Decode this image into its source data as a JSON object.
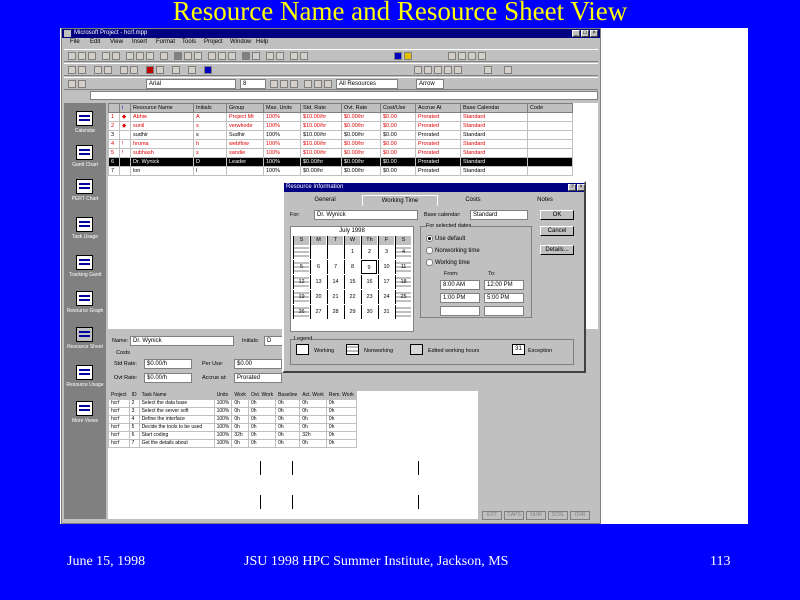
{
  "slide": {
    "title": "Resource Name and Resource Sheet View",
    "footer_date": "June 15,  1998",
    "footer_event": "JSU 1998 HPC Summer Institute, Jackson, MS",
    "page_number": "113"
  },
  "window": {
    "title": "Microsoft Project - hcrf.mpp",
    "menus": [
      "File",
      "Edit",
      "View",
      "Insert",
      "Format",
      "Tools",
      "Project",
      "Window",
      "Help"
    ]
  },
  "toolbar": {
    "font_box": "Arial",
    "size_box": "8",
    "filter_box": "All Resources",
    "zoom_label": "Arrow"
  },
  "viewbar": [
    {
      "label": "Calendar"
    },
    {
      "label": "Gantt Chart"
    },
    {
      "label": "PERT Chart"
    },
    {
      "label": "Task Usage"
    },
    {
      "label": "Tracking Gantt"
    },
    {
      "label": "Resource Graph"
    },
    {
      "label": "Resource Sheet"
    },
    {
      "label": "Resource Usage"
    },
    {
      "label": "More Views"
    }
  ],
  "sheet": {
    "headers": [
      "",
      "i",
      "Resource Name",
      "Initials",
      "Group",
      "Max. Units",
      "Std. Rate",
      "Ovt. Rate",
      "Cost/Use",
      "Accrue At",
      "Base Calendar",
      "Code"
    ],
    "rows": [
      {
        "id": "1",
        "name": "Abhie",
        "initials": "A",
        "group": "Project Mt",
        "max": "100%",
        "std": "$10.00/hr",
        "ovt": "$0.00/hr",
        "cost": "$0.00",
        "accrue": "Prorated",
        "cal": "Standard",
        "style": "red"
      },
      {
        "id": "2",
        "name": "sunil",
        "initials": "s",
        "group": "verwkode",
        "max": "100%",
        "std": "$10.00/hr",
        "ovt": "$0.00/hr",
        "cost": "$0.00",
        "accrue": "Prorated",
        "cal": "Standard",
        "style": "red"
      },
      {
        "id": "3",
        "name": "sudhir",
        "initials": "s",
        "group": "Sudhir",
        "max": "100%",
        "std": "$10.00/hr",
        "ovt": "$0.00/hr",
        "cost": "$0.00",
        "accrue": "Prorated",
        "cal": "Standard",
        "style": "normal"
      },
      {
        "id": "4",
        "name": "hruma",
        "initials": "h",
        "group": "webflow",
        "max": "100%",
        "std": "$10.00/hr",
        "ovt": "$0.00/hr",
        "cost": "$0.00",
        "accrue": "Prorated",
        "cal": "Standard",
        "style": "red"
      },
      {
        "id": "5",
        "name": "subhash",
        "initials": "s",
        "group": "sandie",
        "max": "100%",
        "std": "$10.00/hr",
        "ovt": "$0.00/hr",
        "cost": "$0.00",
        "accrue": "Prorated",
        "cal": "Standard",
        "style": "red"
      },
      {
        "id": "6",
        "name": "Dr. Wynick",
        "initials": "D",
        "group": "Leader",
        "max": "100%",
        "std": "$0.00/hr",
        "ovt": "$0.00/hr",
        "cost": "$0.00",
        "accrue": "Prorated",
        "cal": "Standard",
        "style": "selected"
      },
      {
        "id": "7",
        "name": "lon",
        "initials": "l",
        "group": "",
        "max": "100%",
        "std": "$0.00/hr",
        "ovt": "$0.00/hr",
        "cost": "$0.00",
        "accrue": "Prorated",
        "cal": "Standard",
        "style": "normal"
      }
    ]
  },
  "form": {
    "name_label": "Name:",
    "name_value": "Dr. Wynick",
    "initials_label": "Initials:",
    "initials_value": "D",
    "costs_label": "Costs",
    "std_label": "Std Rate:",
    "std_value": "$0.00/h",
    "per_use_label": "Per Use:",
    "per_use_value": "$0.00",
    "ovt_label": "Ovt Rate:",
    "ovt_value": "$0.00/h",
    "accrue_label": "Accrue at:",
    "accrue_value": "Prorated",
    "table_headers": [
      "Project",
      "ID",
      "Task Name",
      "Units",
      "Work",
      "Ovt. Work",
      "Baseline",
      "Act. Work",
      "Rem. Work"
    ],
    "table_rows": [
      [
        "hcrf",
        "2",
        "Select the data base",
        "100%",
        "0h",
        "0h",
        "0h",
        "0h",
        "0h"
      ],
      [
        "hcrf",
        "3",
        "Select the server soft",
        "100%",
        "0h",
        "0h",
        "0h",
        "0h",
        "0h"
      ],
      [
        "hcrf",
        "4",
        "Define the interface",
        "100%",
        "0h",
        "0h",
        "0h",
        "0h",
        "0h"
      ],
      [
        "hcrf",
        "5",
        "Decide the tools to be used",
        "100%",
        "0h",
        "0h",
        "0h",
        "0h",
        "0h"
      ],
      [
        "hcrf",
        "6",
        "Start coding",
        "100%",
        "32h",
        "0h",
        "0h",
        "32h",
        "0h"
      ],
      [
        "hcrf",
        "7",
        "Get the details about",
        "100%",
        "0h",
        "0h",
        "0h",
        "0h",
        "0h"
      ]
    ]
  },
  "dialog": {
    "title": "Resource Information",
    "tabs": [
      "General",
      "Working Time",
      "Costs",
      "Notes"
    ],
    "for_label": "For:",
    "for_value": "Dr. Wynick",
    "base_cal_label": "Base calendar:",
    "base_cal_value": "Standard",
    "month": "July 1998",
    "weekdays": [
      "S",
      "M",
      "T",
      "W",
      "Th",
      "F",
      "S"
    ],
    "weeks": [
      [
        "",
        "",
        "",
        "1",
        "2",
        "3",
        "4"
      ],
      [
        "5",
        "6",
        "7",
        "8",
        "9",
        "10",
        "11"
      ],
      [
        "12",
        "13",
        "14",
        "15",
        "16",
        "17",
        "18"
      ],
      [
        "19",
        "20",
        "21",
        "22",
        "23",
        "24",
        "25"
      ],
      [
        "26",
        "27",
        "28",
        "29",
        "30",
        "31",
        ""
      ]
    ],
    "set_group_label": "For selected dates",
    "opt_default": "Use default",
    "opt_nonworking": "Nonworking time",
    "opt_working": "Working time",
    "from_label": "From:",
    "to_label": "To:",
    "from1": "8:00 AM",
    "to1": "12:00 PM",
    "from2": "1:00 PM",
    "to2": "5:00 PM",
    "ok_label": "OK",
    "cancel_label": "Cancel",
    "details_label": "Details...",
    "legend_title": "Legend",
    "legend_working": "Working",
    "legend_nonworking": "Nonworking",
    "legend_edited": "Edited working hours",
    "legend_exception_num": "31",
    "legend_exception": "Exception"
  },
  "status": [
    "EXT",
    "CAPS",
    "NUM",
    "SCRL",
    "OVR"
  ]
}
